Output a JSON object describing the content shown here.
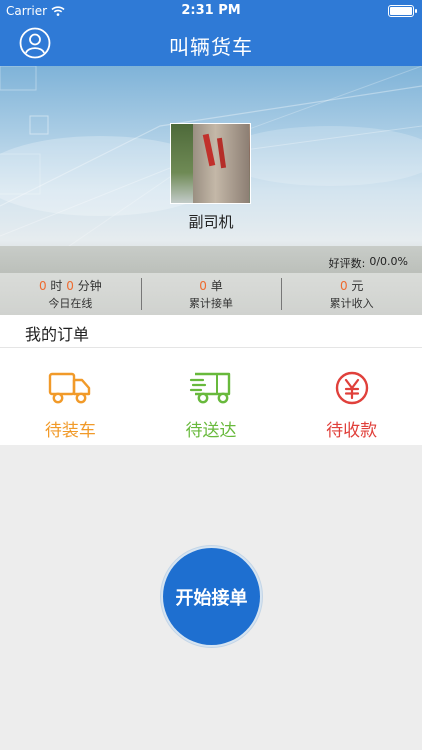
{
  "status": {
    "carrier": "Carrier",
    "time": "2:31 PM"
  },
  "nav": {
    "title": "叫辆货车",
    "avatar_icon": "user-circle-icon"
  },
  "profile": {
    "name": "副司机",
    "rating_label": "好评数:",
    "rating_value": "0/0.0%"
  },
  "stats": [
    {
      "v1": "0",
      "u1": "时",
      "v2": "0",
      "u2": "分钟",
      "label": "今日在线"
    },
    {
      "v1": "0",
      "u1": "单",
      "label": "累计接单"
    },
    {
      "v1": "0",
      "u1": "元",
      "label": "累计收入"
    }
  ],
  "orders": {
    "title": "我的订单",
    "items": [
      {
        "label": "待装车",
        "icon": "truck-icon",
        "color": "#f19a29"
      },
      {
        "label": "待送达",
        "icon": "fast-truck-icon",
        "color": "#68b93c"
      },
      {
        "label": "待收款",
        "icon": "yuan-circle-icon",
        "color": "#e0403b"
      }
    ]
  },
  "start_button": {
    "label": "开始接单",
    "color": "#1e6fd0"
  }
}
